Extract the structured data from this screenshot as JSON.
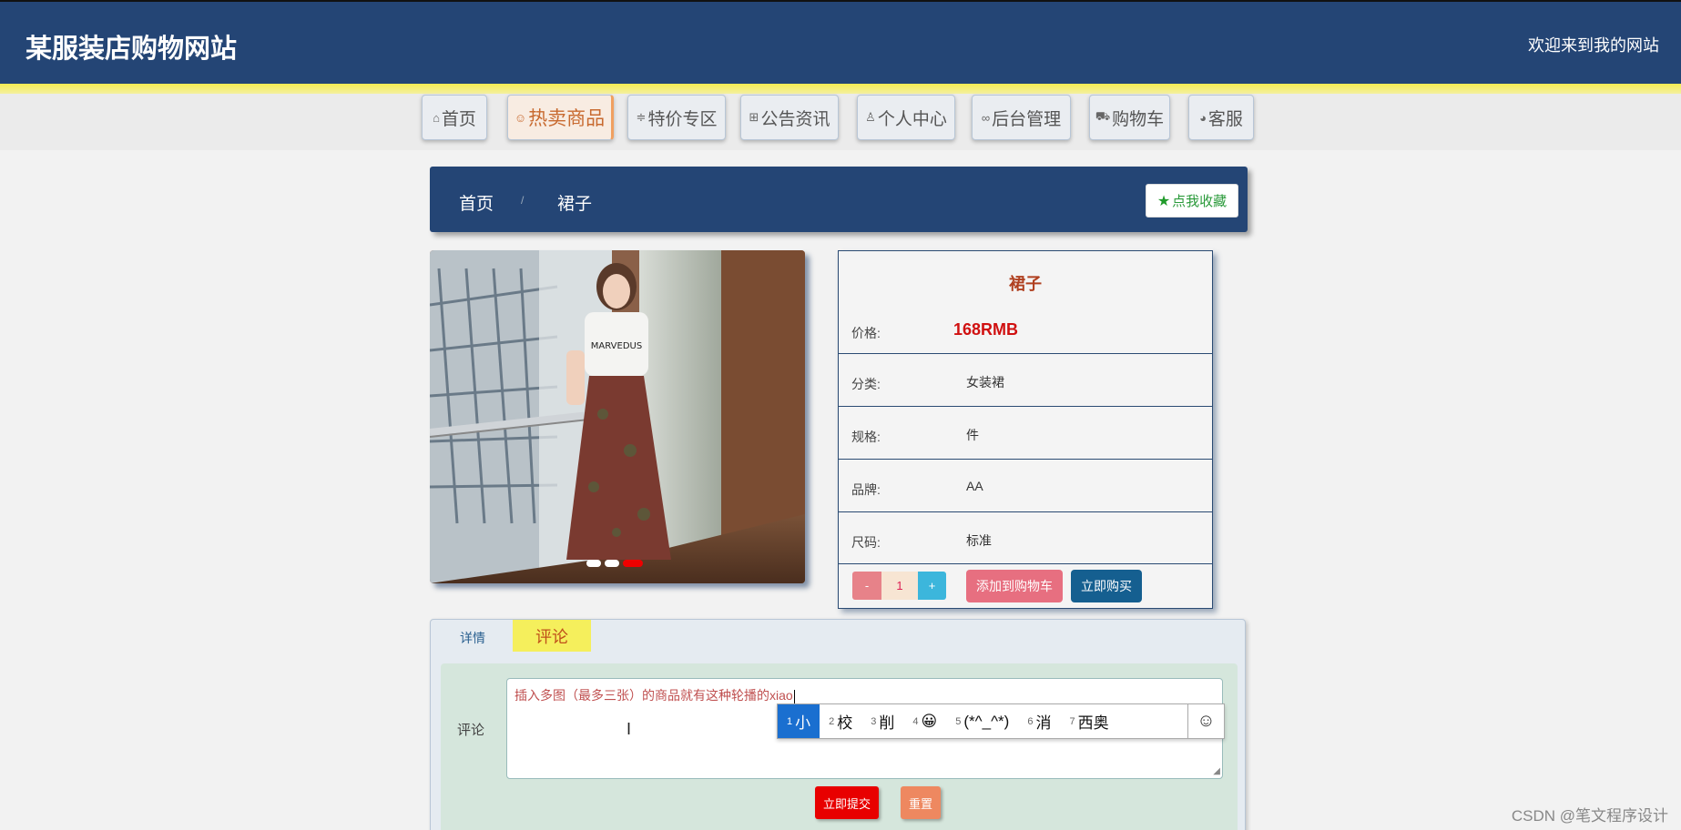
{
  "header": {
    "site_title": "某服装店购物网站",
    "welcome": "欢迎来到我的网站",
    "brand_color": "#244575",
    "accent_color": "#f5ec52"
  },
  "nav": [
    {
      "label": "首页",
      "icon": "home-icon"
    },
    {
      "label": "热卖商品",
      "icon": "hot-icon",
      "active": true
    },
    {
      "label": "特价专区",
      "icon": "sliders-icon"
    },
    {
      "label": "公告资讯",
      "icon": "grid-icon"
    },
    {
      "label": "个人中心",
      "icon": "user-icon"
    },
    {
      "label": "后台管理",
      "icon": "link-icon"
    },
    {
      "label": "购物车",
      "icon": "cart-icon"
    },
    {
      "label": "客服",
      "icon": "chat-icon"
    }
  ],
  "breadcrumb": {
    "home": "首页",
    "separator": "/",
    "current": "裙子",
    "favorite_label": "点我收藏"
  },
  "product": {
    "name": "裙子",
    "price_label": "价格:",
    "price": "168RMB",
    "category_label": "分类:",
    "category": "女装裙",
    "spec_label": "规格:",
    "spec": "件",
    "brand_label": "品牌:",
    "brand": "AA",
    "size_label": "尺码:",
    "size": "标准",
    "quantity": "1",
    "minus_label": "-",
    "plus_label": "+",
    "add_to_cart_label": "添加到购物车",
    "buy_now_label": "立即购买",
    "carousel_slides": 3,
    "carousel_active": 3
  },
  "tabs": {
    "detail_label": "详情",
    "comment_label": "评论"
  },
  "comment": {
    "field_label": "评论",
    "text": "插入多图（最多三张）的商品就有这种轮播的xiao",
    "submit_label": "立即提交",
    "reset_label": "重置"
  },
  "ime": {
    "candidates": [
      {
        "n": "1",
        "text": "小"
      },
      {
        "n": "2",
        "text": "校"
      },
      {
        "n": "3",
        "text": "削"
      },
      {
        "n": "4",
        "text": "😀"
      },
      {
        "n": "5",
        "text": "(*^_^*)"
      },
      {
        "n": "6",
        "text": "消"
      },
      {
        "n": "7",
        "text": "西奥"
      }
    ],
    "emoji_button": "☺"
  },
  "watermark": "CSDN @笔文程序设计"
}
